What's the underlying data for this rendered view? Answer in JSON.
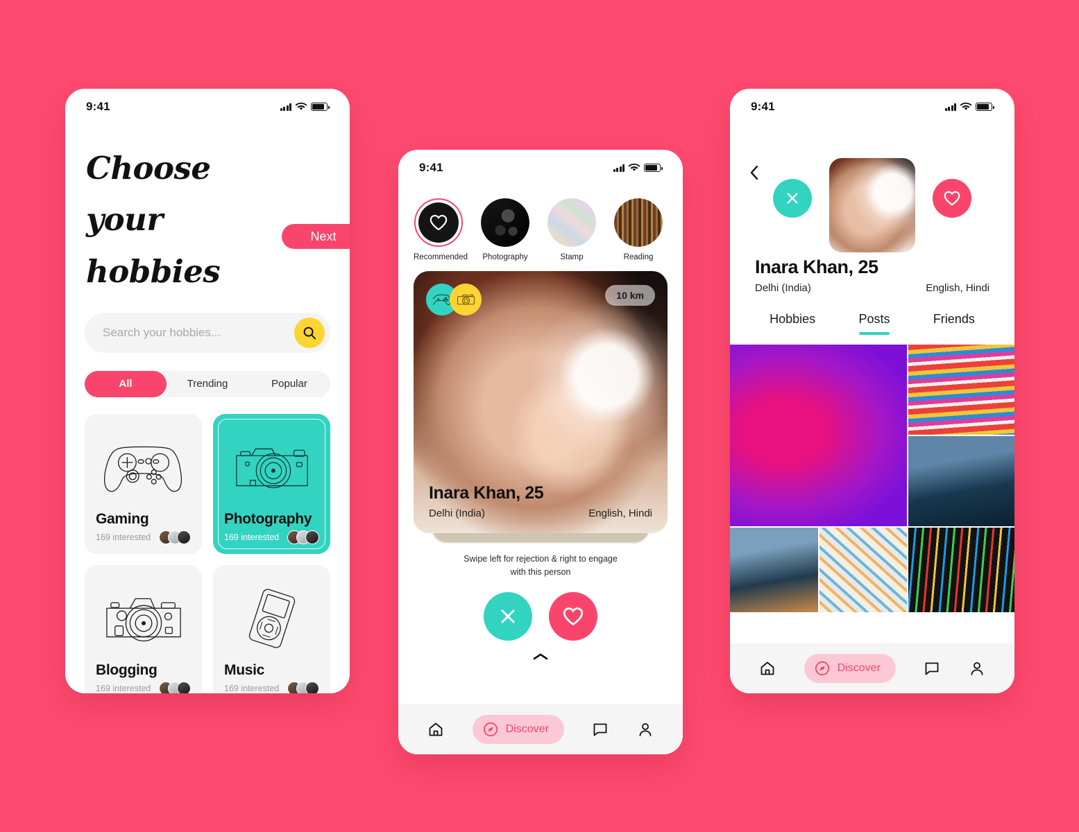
{
  "background_color": "#ff4a6f",
  "accent_pink": "#f9456b",
  "accent_teal": "#33d3c2",
  "accent_yellow": "#fcd434",
  "status_bar": {
    "time": "9:41"
  },
  "phone1": {
    "next_button": "Next",
    "title_line1": "Choose your",
    "title_line2": "hobbies",
    "search": {
      "placeholder": "Search your hobbies...",
      "value": "",
      "icon": "search-icon"
    },
    "filters": [
      {
        "label": "All",
        "active": true
      },
      {
        "label": "Trending",
        "active": false
      },
      {
        "label": "Popular",
        "active": false
      }
    ],
    "hobby_cards": [
      {
        "name": "Gaming",
        "interested": "169 interested",
        "icon": "gamepad-icon",
        "selected": false
      },
      {
        "name": "Photography",
        "interested": "169 interested",
        "icon": "dslr-camera-icon",
        "selected": true
      },
      {
        "name": "Blogging",
        "interested": "169 interested",
        "icon": "film-camera-icon",
        "selected": false
      },
      {
        "name": "Music",
        "interested": "169 interested",
        "icon": "ipod-icon",
        "selected": false
      }
    ]
  },
  "phone2": {
    "categories": [
      {
        "label": "Recommended",
        "active": true,
        "icon": "heart-icon"
      },
      {
        "label": "Photography",
        "active": false,
        "icon": "camera-photo"
      },
      {
        "label": "Stamp",
        "active": false,
        "icon": "stamps-photo"
      },
      {
        "label": "Reading",
        "active": false,
        "icon": "bookshelf-photo"
      }
    ],
    "card": {
      "badges": [
        "gamepad-icon",
        "dslr-camera-icon"
      ],
      "distance": "10 km",
      "name": "Inara Khan, 25",
      "location": "Delhi (India)",
      "languages": "English, Hindi"
    },
    "swipe_hint_line1": "Swipe left for rejection & right to engage",
    "swipe_hint_line2": "with this person",
    "actions": [
      {
        "name": "reject",
        "icon": "close-icon",
        "color": "#33d3c2"
      },
      {
        "name": "like",
        "icon": "heart-icon",
        "color": "#f9456b"
      }
    ],
    "expand_icon": "chevron-up-icon",
    "bottom_nav": [
      {
        "label": "",
        "icon": "home-icon",
        "active": false
      },
      {
        "label": "Discover",
        "icon": "compass-icon",
        "active": true
      },
      {
        "label": "",
        "icon": "chat-icon",
        "active": false
      },
      {
        "label": "",
        "icon": "person-icon",
        "active": false
      }
    ]
  },
  "phone3": {
    "back_icon": "chevron-left-icon",
    "reject_icon": "close-icon",
    "like_icon": "heart-icon",
    "name": "Inara Khan, 25",
    "location": "Delhi (India)",
    "languages": "English, Hindi",
    "tabs": [
      {
        "label": "Hobbies",
        "active": false
      },
      {
        "label": "Posts",
        "active": true
      },
      {
        "label": "Friends",
        "active": false
      }
    ],
    "posts": [
      {
        "name": "gaming-controller-neon-photo"
      },
      {
        "name": "graffiti-face-art-photo"
      },
      {
        "name": "woman-with-camera-city-photo"
      },
      {
        "name": "woman-photographer-dusk-photo"
      },
      {
        "name": "abstract-paint-photo"
      },
      {
        "name": "rgb-keyboard-photo"
      }
    ],
    "bottom_nav": [
      {
        "label": "",
        "icon": "home-icon",
        "active": false
      },
      {
        "label": "Discover",
        "icon": "compass-icon",
        "active": true
      },
      {
        "label": "",
        "icon": "chat-icon",
        "active": false
      },
      {
        "label": "",
        "icon": "person-icon",
        "active": false
      }
    ]
  }
}
